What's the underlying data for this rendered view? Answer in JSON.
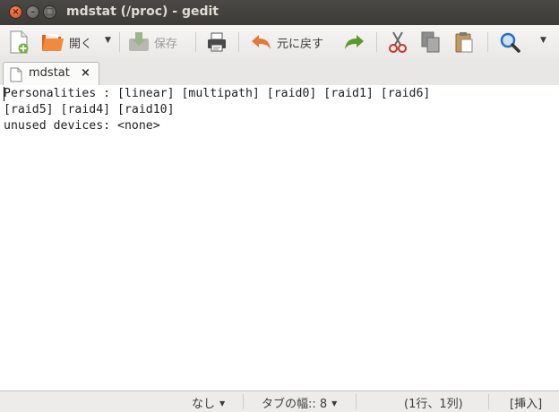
{
  "window": {
    "title": "mdstat (/proc) - gedit",
    "close_glyph": "×",
    "minimize_glyph": "–",
    "maximize_glyph": "□"
  },
  "toolbar": {
    "new_icon": "new-document-icon",
    "open_label": "開く",
    "open_icon": "open-folder-icon",
    "save_label": "保存",
    "save_icon": "save-icon",
    "print_icon": "print-icon",
    "undo_label": "元に戻す",
    "undo_icon": "undo-arrow-icon",
    "redo_icon": "redo-arrow-icon",
    "cut_icon": "scissors-icon",
    "copy_icon": "copy-icon",
    "paste_icon": "paste-icon",
    "search_icon": "magnifier-icon",
    "dropdown_glyph": "▼"
  },
  "tab": {
    "label": "mdstat",
    "close_glyph": "×"
  },
  "editor": {
    "lines": [
      "Personalities : [linear] [multipath] [raid0] [raid1] [raid6]",
      "[raid5] [raid4] [raid10]",
      "unused devices: <none>"
    ]
  },
  "statusbar": {
    "highlight_mode": "なし",
    "tab_width": "タブの幅:: 8",
    "cursor_position": "(1行、1列)",
    "insert_mode": "[挿入]",
    "dropdown_glyph": "▼"
  },
  "colors": {
    "titlebar": "#3c3b37",
    "close_button": "#e0431b",
    "undo_arrow": "#e07a3a",
    "redo_arrow": "#5a9a2a",
    "search_icon": "#2a6ebd"
  }
}
